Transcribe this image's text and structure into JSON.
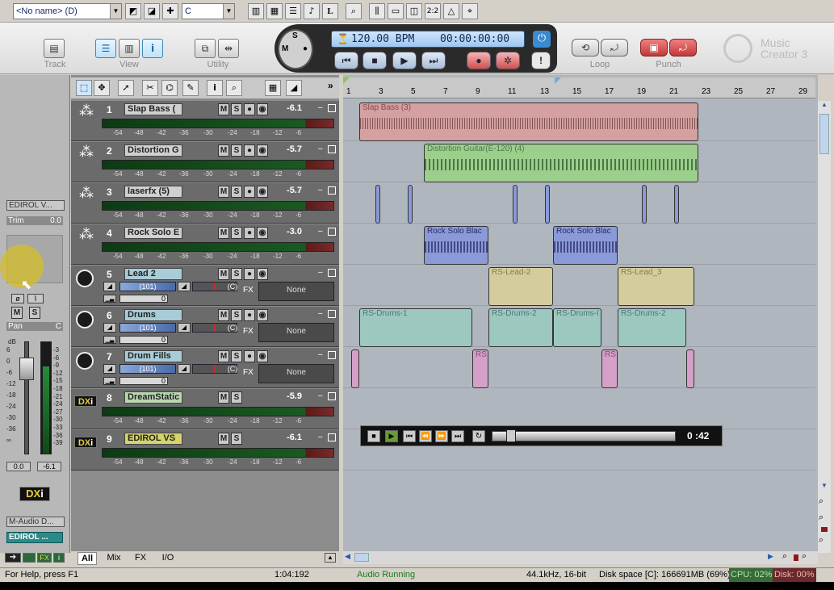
{
  "toolbar1": {
    "preset_combo": "<No name> (D)",
    "key_combo": "C"
  },
  "toolbar2": {
    "groups": {
      "track": "Track",
      "view": "View",
      "utility": "Utility",
      "loop": "Loop",
      "punch": "Punch"
    },
    "tempo": "120.00 BPM",
    "time": "00:00:00:00",
    "app_name_line1": "Music",
    "app_name_line2": "Creator 3"
  },
  "left": {
    "device": "EDIROL V...",
    "trim_label": "Trim",
    "trim_value": "0.0",
    "pan_label": "Pan",
    "pan_value": "C",
    "db_label": "dB",
    "fader_value": "0.0",
    "peak_value": "-6.1",
    "output": "M-Audio D...",
    "instrument": "EDIROL ...",
    "db_ticks": [
      "6",
      "0",
      "-6",
      "-12",
      "-18",
      "-24",
      "-30",
      "-36",
      "∞"
    ],
    "meter_ticks": [
      "-3",
      "-6",
      "-9",
      "-12",
      "-15",
      "-18",
      "-21",
      "-24",
      "-27",
      "-30",
      "-33",
      "-36",
      "-39"
    ]
  },
  "scale": [
    "-54",
    "-48",
    "-42",
    "-36",
    "-30",
    "-24",
    "-18",
    "-12",
    "-6"
  ],
  "tracks": [
    {
      "num": "1",
      "name": "Slap Bass (",
      "vol": "-6.1",
      "kind": "audio"
    },
    {
      "num": "2",
      "name": "Distortion G",
      "vol": "-5.7",
      "kind": "audio"
    },
    {
      "num": "3",
      "name": "laserfx (5)",
      "vol": "-5.7",
      "kind": "audio"
    },
    {
      "num": "4",
      "name": "Rock Solo E",
      "vol": "-3.0",
      "kind": "audio"
    },
    {
      "num": "5",
      "name": "Lead 2",
      "vol_bar": "(101)",
      "pan": "(C)",
      "fx": "FX",
      "fxval": "None",
      "count": "0",
      "kind": "synth"
    },
    {
      "num": "6",
      "name": "Drums",
      "vol_bar": "(101)",
      "pan": "(C)",
      "fx": "FX",
      "fxval": "None",
      "count": "0",
      "kind": "synth"
    },
    {
      "num": "7",
      "name": "Drum Fills",
      "vol_bar": "(101)",
      "pan": "(C)",
      "fx": "FX",
      "fxval": "None",
      "count": "0",
      "kind": "synth"
    },
    {
      "num": "8",
      "name": "DreamStatic",
      "vol": "-5.9",
      "kind": "dx"
    },
    {
      "num": "9",
      "name": "EDIROL VS",
      "vol": "-6.1",
      "kind": "dxsel"
    }
  ],
  "msr": [
    "M",
    "S"
  ],
  "ruler": [
    "1",
    "3",
    "5",
    "7",
    "9",
    "11",
    "13",
    "15",
    "17",
    "19",
    "21",
    "23",
    "25",
    "27",
    "29"
  ],
  "clips": {
    "slap": "Slap Bass (3)",
    "dist": "Distortion Guitar(E-120) (4)",
    "rock1": "Rock Solo Blac",
    "rock2": "Rock Solo Blac",
    "lead1": "RS-Lead-2",
    "lead2": "RS-Lead_3",
    "drum1": "RS-Drums-1",
    "drum2": "RS-Drums-2",
    "drum3": "RS-Drums-I",
    "drum4": "RS-Drums-2",
    "fill1": "RS",
    "fill2": "RS"
  },
  "player": {
    "time": "0 :42"
  },
  "tabs": [
    "All",
    "Mix",
    "FX",
    "I/O"
  ],
  "status": {
    "help": "For Help, press F1",
    "pos": "1:04:192",
    "state": "Audio Running",
    "format": "44.1kHz, 16-bit",
    "disk": "Disk space [C]: 166691MB (69%)",
    "cpu": "CPU: 02%",
    "disk_load": "Disk: 00%"
  },
  "icons": {
    "dxi": "DX",
    "dxi_i": "i",
    "fx_btn": "FX",
    "mute": "M",
    "solo": "S"
  }
}
